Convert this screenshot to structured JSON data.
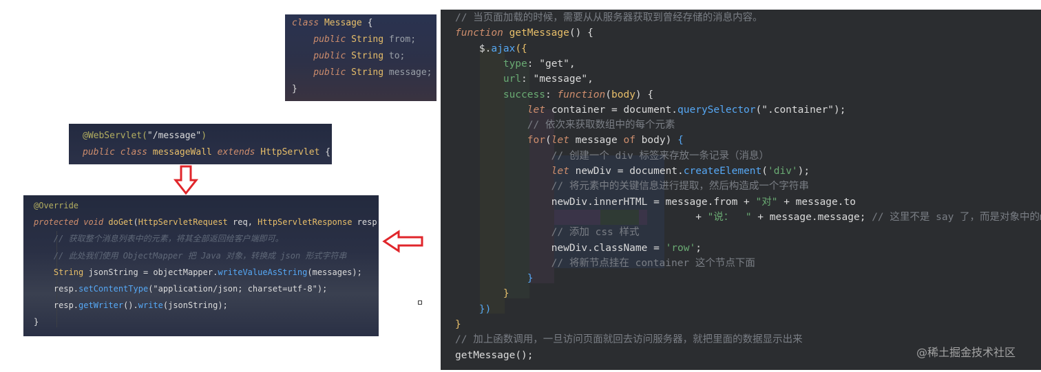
{
  "panel_class_message": {
    "lines": [
      [
        {
          "t": "class ",
          "c": "kw"
        },
        {
          "t": "Message",
          "c": "cls"
        },
        {
          "t": " {",
          "c": "id"
        }
      ],
      [
        {
          "t": "    public ",
          "c": "ktw"
        },
        {
          "t": "String ",
          "c": "typ"
        },
        {
          "t": "from;",
          "c": "fld"
        }
      ],
      [
        {
          "t": "    public ",
          "c": "ktw"
        },
        {
          "t": "String ",
          "c": "typ"
        },
        {
          "t": "to;",
          "c": "fld"
        }
      ],
      [
        {
          "t": "    public ",
          "c": "ktw"
        },
        {
          "t": "String ",
          "c": "typ"
        },
        {
          "t": "message;",
          "c": "fld"
        }
      ],
      [
        {
          "t": "}",
          "c": "id"
        }
      ]
    ]
  },
  "panel_servlet": {
    "lines": [
      [
        {
          "t": "@WebServlet(",
          "c": "ann"
        },
        {
          "t": "\"/message\"",
          "c": "id"
        },
        {
          "t": ")",
          "c": "ann"
        }
      ],
      [
        {
          "t": "public class ",
          "c": "kw"
        },
        {
          "t": "messageWall ",
          "c": "cls"
        },
        {
          "t": "extends ",
          "c": "kw"
        },
        {
          "t": "HttpServlet",
          "c": "cls"
        },
        {
          "t": " {",
          "c": "id"
        }
      ]
    ]
  },
  "panel_doget": {
    "lines": [
      [
        {
          "t": "@Override",
          "c": "ann"
        }
      ],
      [
        {
          "t": "protected void ",
          "c": "kw"
        },
        {
          "t": "doGet",
          "c": "fnd"
        },
        {
          "t": "(",
          "c": "id"
        },
        {
          "t": "HttpServletRequest ",
          "c": "cls"
        },
        {
          "t": "req",
          "c": "id"
        },
        {
          "t": ", ",
          "c": "id"
        },
        {
          "t": "HttpServletResponse ",
          "c": "cls"
        },
        {
          "t": "resp",
          "c": "id"
        }
      ],
      [
        {
          "t": "    // 获取整个消息列表中的元素，将其全部返回给客户端即可。",
          "c": "cmti"
        }
      ],
      [
        {
          "t": "    // 此处我们使用 ObjectMapper 把 Java 对象，转换成 json 形式字符串",
          "c": "cmti"
        }
      ],
      [
        {
          "t": "    String ",
          "c": "typ"
        },
        {
          "t": "jsonString = objectMapper.",
          "c": "id"
        },
        {
          "t": "writeValueAsString",
          "c": "fn"
        },
        {
          "t": "(messages);",
          "c": "id"
        }
      ],
      [
        {
          "t": "    resp.",
          "c": "id"
        },
        {
          "t": "setContentType",
          "c": "fn"
        },
        {
          "t": "(",
          "c": "id"
        },
        {
          "t": "\"application/json; charset=utf-8\"",
          "c": "id"
        },
        {
          "t": ");",
          "c": "id"
        }
      ],
      [
        {
          "t": "    resp.",
          "c": "id"
        },
        {
          "t": "getWriter",
          "c": "fn"
        },
        {
          "t": "().",
          "c": "id"
        },
        {
          "t": "write",
          "c": "fn"
        },
        {
          "t": "(jsonString);",
          "c": "id"
        }
      ],
      [
        {
          "t": "}",
          "c": "id"
        }
      ]
    ]
  },
  "panel_js": {
    "lines": [
      [
        {
          "t": "// 当页面加载的时候，需要从从服务器获取到曾经存储的消息内容。",
          "c": "cmt"
        }
      ],
      [
        {
          "t": "function ",
          "c": "kw"
        },
        {
          "t": "getMessage",
          "c": "fnd"
        },
        {
          "t": "() {",
          "c": "id"
        }
      ],
      [
        {
          "t": "    $.",
          "c": "id"
        },
        {
          "t": "ajax",
          "c": "fn"
        },
        {
          "t": "({",
          "c": "cls"
        }
      ],
      [
        {
          "t": "        ",
          "c": "id"
        },
        {
          "t": "type",
          "c": "str"
        },
        {
          "t": ": ",
          "c": "id"
        },
        {
          "t": "\"get\"",
          "c": "id"
        },
        {
          "t": ",",
          "c": "id"
        }
      ],
      [
        {
          "t": "        ",
          "c": "id"
        },
        {
          "t": "url",
          "c": "str"
        },
        {
          "t": ": ",
          "c": "id"
        },
        {
          "t": "\"message\"",
          "c": "id"
        },
        {
          "t": ",",
          "c": "id"
        }
      ],
      [
        {
          "t": "        ",
          "c": "id"
        },
        {
          "t": "success",
          "c": "str"
        },
        {
          "t": ": ",
          "c": "id"
        },
        {
          "t": "function",
          "c": "kw"
        },
        {
          "t": "(",
          "c": "id"
        },
        {
          "t": "body",
          "c": "cls"
        },
        {
          "t": ") {",
          "c": "id"
        }
      ],
      [
        {
          "t": "            ",
          "c": "id"
        },
        {
          "t": "let ",
          "c": "kw"
        },
        {
          "t": "container = ",
          "c": "id"
        },
        {
          "t": "document.",
          "c": "id"
        },
        {
          "t": "querySelector",
          "c": "fn"
        },
        {
          "t": "(",
          "c": "id"
        },
        {
          "t": "\".container\"",
          "c": "id"
        },
        {
          "t": ");",
          "c": "id"
        }
      ],
      [
        {
          "t": "            // 依次来获取数组中的每个元素",
          "c": "cmt"
        }
      ],
      [
        {
          "t": "            ",
          "c": "id"
        },
        {
          "t": "for",
          "c": "kwb"
        },
        {
          "t": "(",
          "c": "id"
        },
        {
          "t": "let ",
          "c": "kw"
        },
        {
          "t": "message ",
          "c": "id"
        },
        {
          "t": "of ",
          "c": "kwb"
        },
        {
          "t": "body) ",
          "c": "id"
        },
        {
          "t": "{",
          "c": "fn"
        }
      ],
      [
        {
          "t": "                // 创建一个 div 标签来存放一条记录（消息）",
          "c": "cmt"
        }
      ],
      [
        {
          "t": "                ",
          "c": "id"
        },
        {
          "t": "let ",
          "c": "kw"
        },
        {
          "t": "newDiv = ",
          "c": "id"
        },
        {
          "t": "document.",
          "c": "id"
        },
        {
          "t": "createElement",
          "c": "fn"
        },
        {
          "t": "(",
          "c": "id"
        },
        {
          "t": "'div'",
          "c": "str"
        },
        {
          "t": ");",
          "c": "id"
        }
      ],
      [
        {
          "t": "                // 将元素中的关键信息进行提取，然后构造成一个字符串",
          "c": "cmt"
        }
      ],
      [
        {
          "t": "                ",
          "c": "id"
        },
        {
          "t": "newDiv.innerHTML = message.from + ",
          "c": "id"
        },
        {
          "t": "\"对\"",
          "c": "str"
        },
        {
          "t": " + message.to",
          "c": "id"
        }
      ],
      [
        {
          "t": "                                        + ",
          "c": "id"
        },
        {
          "t": "\"说：  \"",
          "c": "str"
        },
        {
          "t": " + message.message; ",
          "c": "id"
        },
        {
          "t": "// 这里不是 say 了，而是对象中的message",
          "c": "cmt"
        }
      ],
      [
        {
          "t": "                // 添加 css 样式",
          "c": "cmt"
        }
      ],
      [
        {
          "t": "                ",
          "c": "id"
        },
        {
          "t": "newDiv.className = ",
          "c": "id"
        },
        {
          "t": "'row'",
          "c": "str"
        },
        {
          "t": ";",
          "c": "id"
        }
      ],
      [
        {
          "t": "                // 将新节点挂在 container 这个节点下面",
          "c": "cmt"
        }
      ],
      [
        {
          "t": "            ",
          "c": "id"
        },
        {
          "t": "}",
          "c": "fn"
        }
      ],
      [
        {
          "t": "        }",
          "c": "cls"
        }
      ],
      [
        {
          "t": "    ",
          "c": "id"
        },
        {
          "t": "})",
          "c": "fn"
        }
      ],
      [
        {
          "t": "}",
          "c": "cls"
        }
      ],
      [
        {
          "t": "// 加上函数调用，一旦访问页面就回去访问服务器，就把里面的数据显示出来",
          "c": "cmt"
        }
      ],
      [
        {
          "t": "getMessage",
          "c": "id"
        },
        {
          "t": "();",
          "c": "id"
        }
      ]
    ]
  },
  "watermark": "@稀土掘金技术社区",
  "colors": {
    "arrow_red": "#e0262b",
    "js_bg": "#2b2d30",
    "keyword": "#cf8e6d",
    "string": "#6aab73",
    "method": "#56a8f5"
  }
}
